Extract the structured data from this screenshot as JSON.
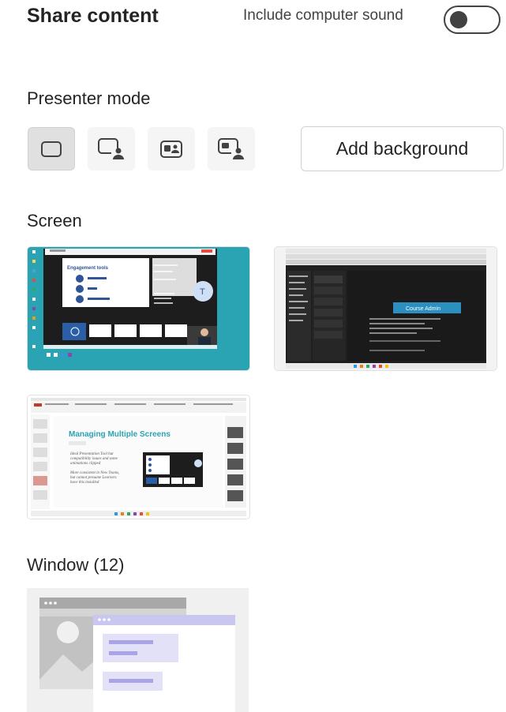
{
  "header": {
    "title": "Share content",
    "sound_label": "Include computer sound",
    "sound_toggle_on": false
  },
  "presenter": {
    "heading": "Presenter mode",
    "modes": [
      {
        "icon": "content-only-icon",
        "selected": true
      },
      {
        "icon": "standout-icon",
        "selected": false
      },
      {
        "icon": "side-by-side-icon",
        "selected": false
      },
      {
        "icon": "reporter-icon",
        "selected": false
      }
    ],
    "add_background_label": "Add background"
  },
  "screen": {
    "heading": "Screen",
    "screens": [
      {
        "lines": [
          "Engagement tools"
        ],
        "theme": "teal"
      },
      {
        "lines": [
          "Course Admin"
        ],
        "theme": "dark"
      },
      {
        "lines": [
          "Managing Multiple Screens",
          "Ideal Presentation Tool but",
          "compatibility issues and some",
          "animations clipped",
          "More consistent in New Teams,",
          "but cannot presume Learners",
          "have this installed"
        ],
        "theme": "light"
      }
    ]
  },
  "window": {
    "heading": "Window (12)"
  },
  "colors": {
    "teal": "#2aa3b3",
    "accent_purple": "#c9c6f0",
    "toggle_border": "#424242"
  }
}
